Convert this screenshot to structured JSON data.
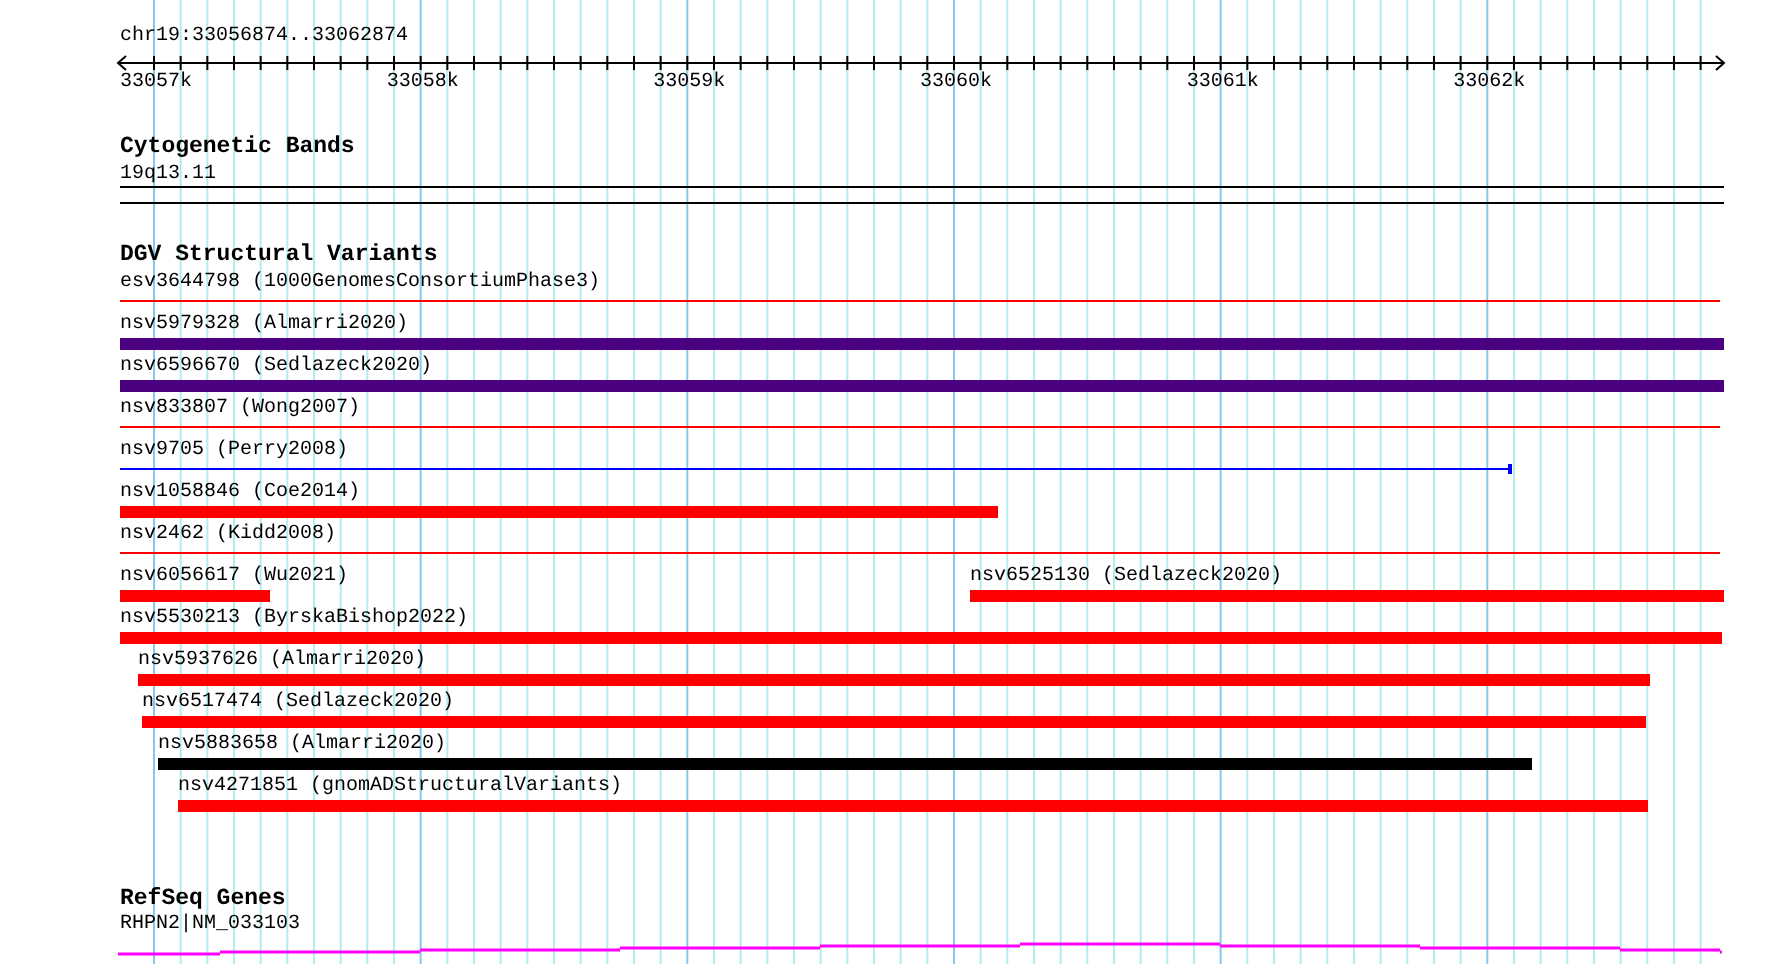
{
  "location": "chr19:33056874..33062874",
  "ruler": {
    "ticks": [
      "33057k",
      "33058k",
      "33059k",
      "33060k",
      "33061k",
      "33062k"
    ]
  },
  "cytoband": {
    "title": "Cytogenetic Bands",
    "label": "19q13.11"
  },
  "dgv": {
    "title": "DGV Structural Variants",
    "rows": [
      [
        {
          "label": "esv3644798 (1000GenomesConsortiumPhase3)",
          "kind": "line",
          "color": "#ff0000"
        }
      ],
      [
        {
          "label": "nsv5979328 (Almarri2020)",
          "kind": "bar",
          "color": "#4b0082"
        }
      ],
      [
        {
          "label": "nsv6596670 (Sedlazeck2020)",
          "kind": "bar",
          "color": "#4b0082"
        }
      ],
      [
        {
          "label": "nsv833807 (Wong2007)",
          "kind": "line",
          "color": "#ff0000"
        }
      ],
      [
        {
          "label": "nsv9705 (Perry2008)",
          "kind": "line",
          "color": "#0000ff"
        }
      ],
      [
        {
          "label": "nsv1058846 (Coe2014)",
          "kind": "bar",
          "color": "#ff0000"
        }
      ],
      [
        {
          "label": "nsv2462 (Kidd2008)",
          "kind": "line",
          "color": "#ff0000"
        }
      ],
      [
        {
          "label": "nsv6056617 (Wu2021)",
          "kind": "bar",
          "color": "#ff0000"
        },
        {
          "label": "nsv6525130 (Sedlazeck2020)",
          "kind": "bar",
          "color": "#ff0000"
        }
      ],
      [
        {
          "label": "nsv5530213 (ByrskaBishop2022)",
          "kind": "bar",
          "color": "#ff0000"
        }
      ],
      [
        {
          "label": "nsv5937626 (Almarri2020)",
          "kind": "bar",
          "color": "#ff0000"
        }
      ],
      [
        {
          "label": "nsv6517474 (Sedlazeck2020)",
          "kind": "bar",
          "color": "#ff0000"
        }
      ],
      [
        {
          "label": "nsv5883658 (Almarri2020)",
          "kind": "bar",
          "color": "#000000"
        }
      ],
      [
        {
          "label": "nsv4271851 (gnomADStructuralVariants)",
          "kind": "bar",
          "color": "#ff0000"
        }
      ]
    ]
  },
  "refseq": {
    "title": "RefSeq Genes",
    "label": "RHPN2|NM_033103",
    "color": "#ff00ff"
  }
}
